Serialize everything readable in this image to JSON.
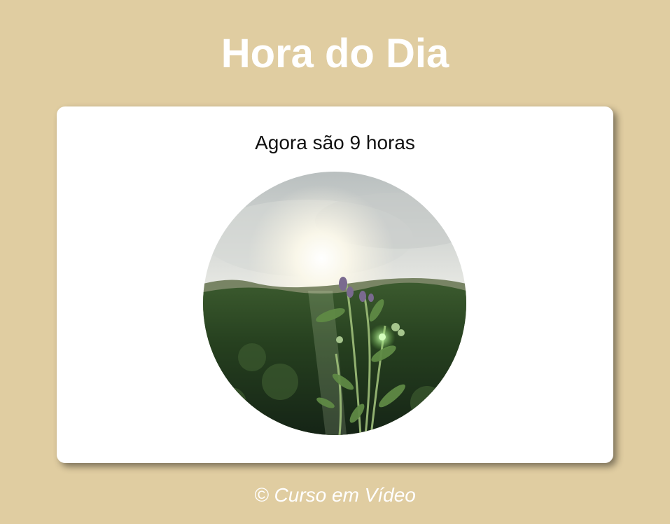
{
  "header": {
    "title": "Hora do Dia"
  },
  "main": {
    "message": "Agora são 9 horas",
    "image": {
      "icon": "morning-field-photo"
    }
  },
  "footer": {
    "text": "© Curso em Vídeo"
  },
  "colors": {
    "background": "#e0cda1",
    "card": "#ffffff",
    "title_text": "#ffffff",
    "message_text": "#111111"
  }
}
